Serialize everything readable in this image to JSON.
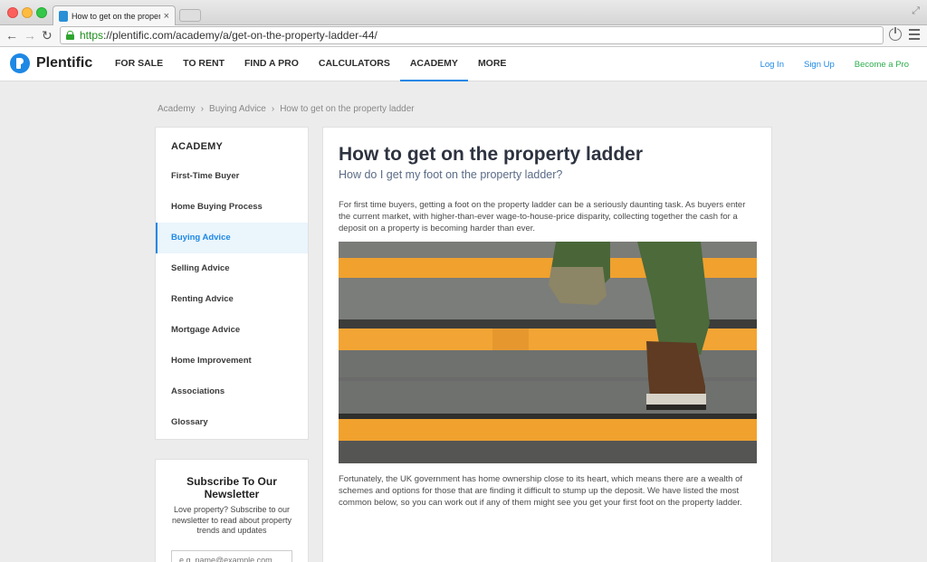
{
  "browser": {
    "tab_title": "How to get on the property ladder",
    "url_scheme": "https",
    "url_rest": "://plentific.com/academy/a/get-on-the-property-ladder-44/"
  },
  "header": {
    "logo": "Plentific",
    "nav": [
      "FOR SALE",
      "TO RENT",
      "FIND A PRO",
      "CALCULATORS",
      "ACADEMY",
      "MORE"
    ],
    "active_nav": "ACADEMY",
    "login": "Log In",
    "signup": "Sign Up",
    "become_pro": "Become a Pro",
    "colors": {
      "accent": "#1e88e5",
      "pro": "#2fae4e"
    }
  },
  "breadcrumb": [
    "Academy",
    "Buying Advice",
    "How to get on the property ladder"
  ],
  "sidebar": {
    "title": "ACADEMY",
    "items": [
      {
        "label": "First-Time Buyer"
      },
      {
        "label": "Home Buying Process"
      },
      {
        "label": "Buying Advice",
        "active": true
      },
      {
        "label": "Selling Advice"
      },
      {
        "label": "Renting Advice"
      },
      {
        "label": "Mortgage Advice"
      },
      {
        "label": "Home Improvement"
      },
      {
        "label": "Associations"
      },
      {
        "label": "Glossary"
      }
    ]
  },
  "newsletter": {
    "title": "Subscribe To Our Newsletter",
    "text": "Love property? Subscribe to our newsletter to read about property trends and updates",
    "placeholder": "e.g. name@example.com"
  },
  "article": {
    "title": "How to get on the property ladder",
    "subtitle": "How do I get my foot on the property ladder?",
    "paragraph1": "For first time buyers, getting a foot on the property ladder can be a seriously daunting task. As buyers enter the current market, with higher-than-ever wage-to-house-price disparity, collecting together the cash for a deposit on a property is becoming harder than ever.",
    "hero_image": "stairs-with-orange-edges-and-shoes",
    "paragraph2": "Fortunately, the UK government has home ownership close to its heart, which means there are a wealth of schemes and options for those that are finding it difficult to stump up the deposit. We have listed the most common below, so you can work out if any of them might see you get your first foot on the property ladder."
  }
}
